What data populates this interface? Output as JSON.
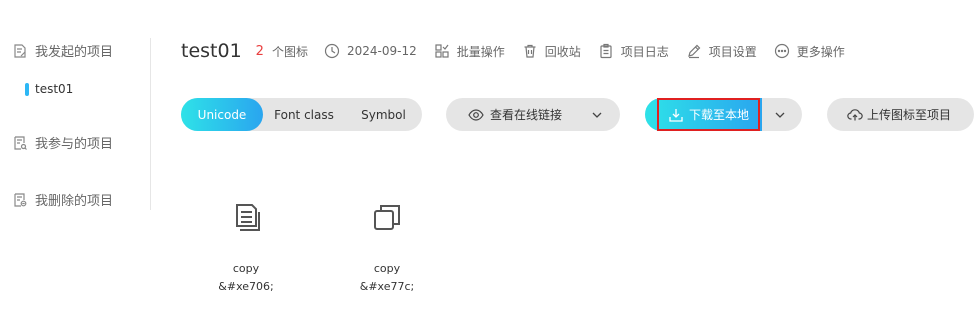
{
  "sidebar": {
    "items": [
      {
        "label": "我发起的项目",
        "icon": "edit-doc-icon"
      },
      {
        "label": "我参与的项目",
        "icon": "doc-search-icon"
      },
      {
        "label": "我删除的项目",
        "icon": "doc-delete-icon"
      }
    ],
    "sub_item": "test01",
    "accent_color": "#2db7f5"
  },
  "header": {
    "project_name": "test01",
    "icon_count": "2",
    "icon_count_label": "个图标",
    "date": "2024-09-12",
    "batch_ops": "批量操作",
    "recycle_bin": "回收站",
    "project_log": "项目日志",
    "project_settings": "项目设置",
    "more_ops": "更多操作"
  },
  "toolbar": {
    "tabs": [
      "Unicode",
      "Font class",
      "Symbol"
    ],
    "active_tab": "Unicode",
    "view_online_link": "查看在线链接",
    "download_local": "下载至本地",
    "upload_to_project": "上传图标至项目",
    "gradient_from": "#2ee2e8",
    "gradient_to": "#2aa5ef",
    "highlight_color": "#e02020"
  },
  "icons": [
    {
      "name": "copy",
      "code": "&#xe706;",
      "icon": "copy-doc-icon"
    },
    {
      "name": "copy",
      "code": "&#xe77c;",
      "icon": "copy-icon"
    }
  ]
}
